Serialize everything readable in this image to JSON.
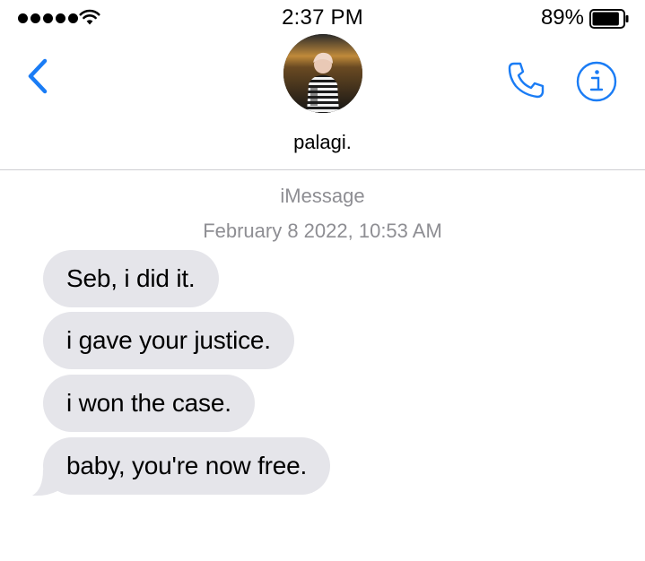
{
  "status_bar": {
    "time": "2:37 PM",
    "battery_percent": "89%",
    "battery_level": 0.89,
    "signal_bars": 5
  },
  "header": {
    "contact_name": "palagi.",
    "icons": {
      "back": "chevron-left-icon",
      "call": "phone-icon",
      "info": "info-icon"
    }
  },
  "thread": {
    "service": "iMessage",
    "timestamp": "February 8 2022, 10:53 AM",
    "messages": [
      {
        "text": "Seb, i did it.",
        "direction": "incoming"
      },
      {
        "text": "i gave your justice.",
        "direction": "incoming"
      },
      {
        "text": "i won the case.",
        "direction": "incoming"
      },
      {
        "text": "baby, you're now free.",
        "direction": "incoming"
      }
    ]
  },
  "colors": {
    "accent": "#1a7cf5",
    "incoming_bubble": "#e5e5ea",
    "meta_text": "#8e8e93"
  }
}
